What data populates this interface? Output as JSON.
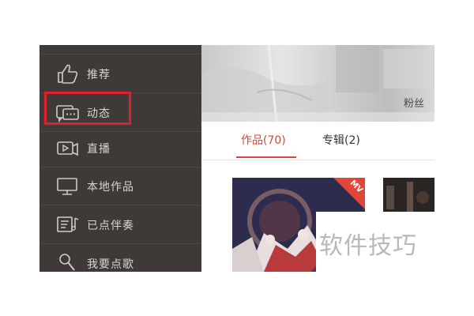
{
  "sidebar": {
    "items": [
      {
        "label": "推荐",
        "icon": "thumbs-up-icon"
      },
      {
        "label": "动态",
        "icon": "chat-bubble-icon",
        "highlighted": true
      },
      {
        "label": "直播",
        "icon": "live-camera-icon"
      },
      {
        "label": "本地作品",
        "icon": "monitor-icon"
      },
      {
        "label": "已点伴奏",
        "icon": "music-list-icon"
      },
      {
        "label": "我要点歌",
        "icon": "microphone-icon"
      }
    ]
  },
  "header": {
    "fans_label": "粉丝"
  },
  "tabs": [
    {
      "label": "作品(70)",
      "active": true
    },
    {
      "label": "专辑(2)",
      "active": false
    }
  ],
  "content": {
    "badge": "MV"
  },
  "watermark": "软件技巧",
  "colors": {
    "sidebar_bg": "#3f3a38",
    "accent": "#d24a3c",
    "highlight": "#e0202a"
  }
}
